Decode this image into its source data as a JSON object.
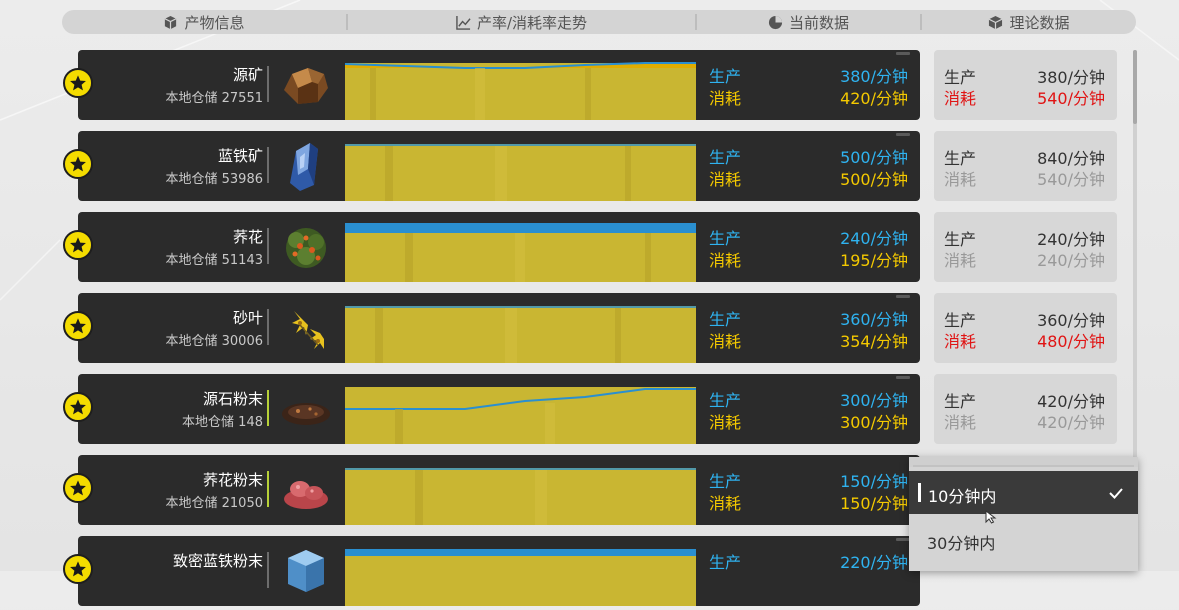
{
  "header": {
    "col1": "产物信息",
    "col2": "产率/消耗率走势",
    "col3": "当前数据",
    "col4": "理论数据",
    "icons": [
      "cube-icon",
      "line-chart-icon",
      "pie-chart-icon",
      "box-icon"
    ]
  },
  "labels": {
    "produce": "生产",
    "consume": "消耗"
  },
  "rows": [
    {
      "name": "源矿",
      "storage": "本地仓储 27551",
      "cur_produce": "380/分钟",
      "cur_consume": "420/分钟",
      "th_produce": "380/分钟",
      "th_consume": "540/分钟",
      "th_consume_red": true,
      "icon": "ore-icon"
    },
    {
      "name": "蓝铁矿",
      "storage": "本地仓储 53986",
      "cur_produce": "500/分钟",
      "cur_consume": "500/分钟",
      "th_produce": "840/分钟",
      "th_consume": "540/分钟",
      "th_consume_red": false,
      "icon": "crystal-icon"
    },
    {
      "name": "荞花",
      "storage": "本地仓储 51143",
      "cur_produce": "240/分钟",
      "cur_consume": "195/分钟",
      "th_produce": "240/分钟",
      "th_consume": "240/分钟",
      "th_consume_red": false,
      "icon": "plant-icon"
    },
    {
      "name": "砂叶",
      "storage": "本地仓储 30006",
      "cur_produce": "360/分钟",
      "cur_consume": "354/分钟",
      "th_produce": "360/分钟",
      "th_consume": "480/分钟",
      "th_consume_red": true,
      "icon": "leaf-icon"
    },
    {
      "name": "源石粉末",
      "storage": "本地仓储 148",
      "cur_produce": "300/分钟",
      "cur_consume": "300/分钟",
      "th_produce": "420/分钟",
      "th_consume": "420/分钟",
      "th_consume_red": false,
      "icon": "powder-icon"
    },
    {
      "name": "荞花粉末",
      "storage": "本地仓储 21050",
      "cur_produce": "150/分钟",
      "cur_consume": "150/分钟",
      "th_produce": "",
      "th_consume": "",
      "th_consume_red": false,
      "icon": "red-powder-icon"
    },
    {
      "name": "致密蓝铁粉末",
      "storage": "",
      "cur_produce": "220/分钟",
      "cur_consume": "",
      "th_produce": "",
      "th_consume": "",
      "th_consume_red": false,
      "icon": "blue-cube-icon"
    }
  ],
  "dropdown": {
    "options": [
      "10分钟内",
      "30分钟内"
    ],
    "selected": "10分钟内"
  },
  "colors": {
    "produce": "#2fb3f0",
    "consume": "#f4c900",
    "warning": "#e01414",
    "star": "#f4dc00"
  }
}
